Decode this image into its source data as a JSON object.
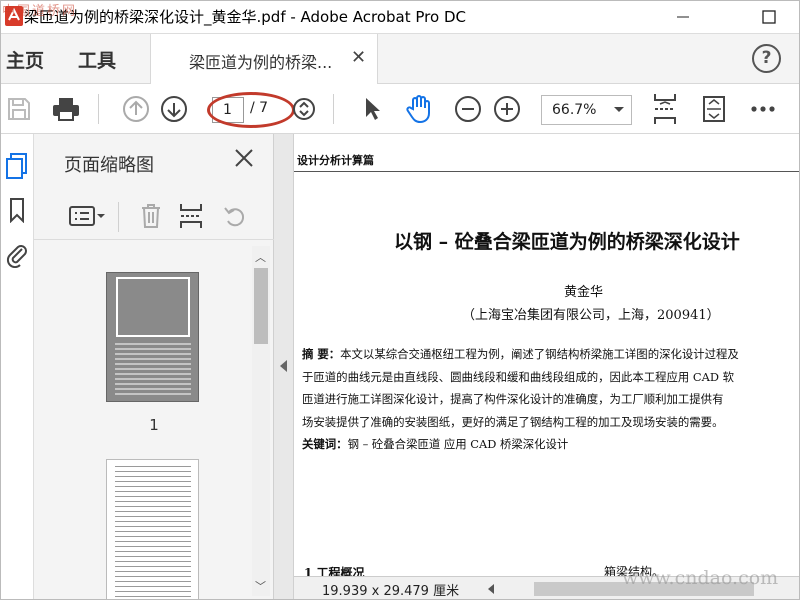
{
  "window": {
    "title": "梁匝道为例的桥梁深化设计_黄金华.pdf - Adobe Acrobat Pro DC"
  },
  "tabs": {
    "home": "主页",
    "tools": "工具",
    "document": "梁匝道为例的桥梁...",
    "help": "?"
  },
  "toolbar": {
    "current_page": "1",
    "total_pages": "/ 7",
    "zoom": "66.7%"
  },
  "thumbnails": {
    "title": "页面缩略图",
    "pages": [
      "1"
    ]
  },
  "document": {
    "running_head": "设计分析计算篇",
    "title": "以钢 – 砼叠合梁匝道为例的桥梁深化设计",
    "author": "黄金华",
    "affiliation": "（上海宝冶集团有限公司，上海，200941）",
    "abstract_label": "摘    要：",
    "abstract_lines": [
      "本文以某综合交通枢纽工程为例，阐述了钢结构桥梁施工详图的深化设计过程及",
      "于匝道的曲线元是由直线段、圆曲线段和缓和曲线段组成的，因此本工程应用 CAD 软",
      "匝道进行施工详图深化设计，提高了构件深化设计的准确度，为工厂顺利加工提供有",
      "场安装提供了准确的安装图纸，更好的满足了钢结构工程的加工及现场安装的需要。"
    ],
    "keywords_label": "关键词：",
    "keywords": "钢 – 砼叠合梁匝道   应用 CAD  桥梁深化设计",
    "section1": "1    工程概况",
    "col2_text": "箱梁结构。"
  },
  "status": {
    "page_size": "19.939 x 29.479 厘米"
  },
  "watermarks": {
    "top_left": "中国道桥网",
    "bottom_right": "www.cndao.com"
  },
  "colors": {
    "acrobat_red": "#d83b2a",
    "annotation_oval": "#c23a2b",
    "active_blue": "#1473e6"
  }
}
